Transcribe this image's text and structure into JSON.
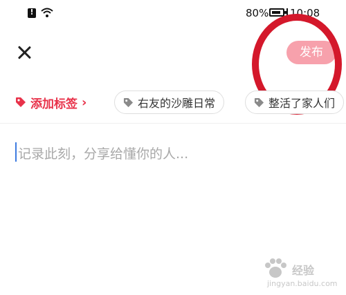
{
  "status_bar": {
    "battery_percent": "80%",
    "time": "10:08"
  },
  "header": {
    "close_icon": "close-icon",
    "publish_label": "发布"
  },
  "tags": {
    "add_label": "添加标签",
    "chips": [
      "右友的沙雕日常",
      "整活了家人们"
    ]
  },
  "editor": {
    "placeholder": "记录此刻，分享给懂你的人..."
  },
  "watermark": {
    "text": "经验",
    "url": "jingyan.baidu.com"
  },
  "colors": {
    "accent": "#e8324a",
    "publish_bg": "#f7a1ac",
    "highlight_circle": "#d4182b",
    "caret": "#3d7be0"
  }
}
